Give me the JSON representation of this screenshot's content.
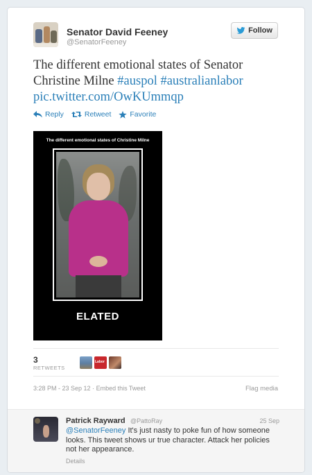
{
  "author": {
    "name": "Senator David Feeney",
    "handle": "@SenatorFeeney"
  },
  "follow_button": {
    "label": "Follow",
    "icon": "twitter-bird-icon"
  },
  "tweet": {
    "text": "The different emotional states of Senator Christine Milne",
    "hashtag1": "#auspol",
    "hashtag2": "#australianlabor",
    "link": "pic.twitter.com/OwKUmmqp"
  },
  "actions": {
    "reply": "Reply",
    "retweet": "Retweet",
    "favorite": "Favorite"
  },
  "media": {
    "caption": "The different emotional states of Christine Milne",
    "word": "ELATED"
  },
  "stats": {
    "retweet_count": "3",
    "retweet_label": "RETWEETS",
    "retweeter_avatar2_text": "Labor"
  },
  "meta": {
    "timestamp": "3:28 PM - 23 Sep 12",
    "separator": " · ",
    "embed": "Embed this Tweet",
    "flag": "Flag media"
  },
  "reply": {
    "name": "Patrick Rayward",
    "handle": "@PattoRay",
    "date": "25 Sep",
    "mention": "@SenatorFeeney",
    "text": " It's just nasty to poke fun of how someone looks. This tweet shows ur true character. Attack her policies not her appearance.",
    "details": "Details"
  },
  "colors": {
    "link": "#2a7fb8",
    "muted": "#999999",
    "background": "#e9eef2"
  }
}
